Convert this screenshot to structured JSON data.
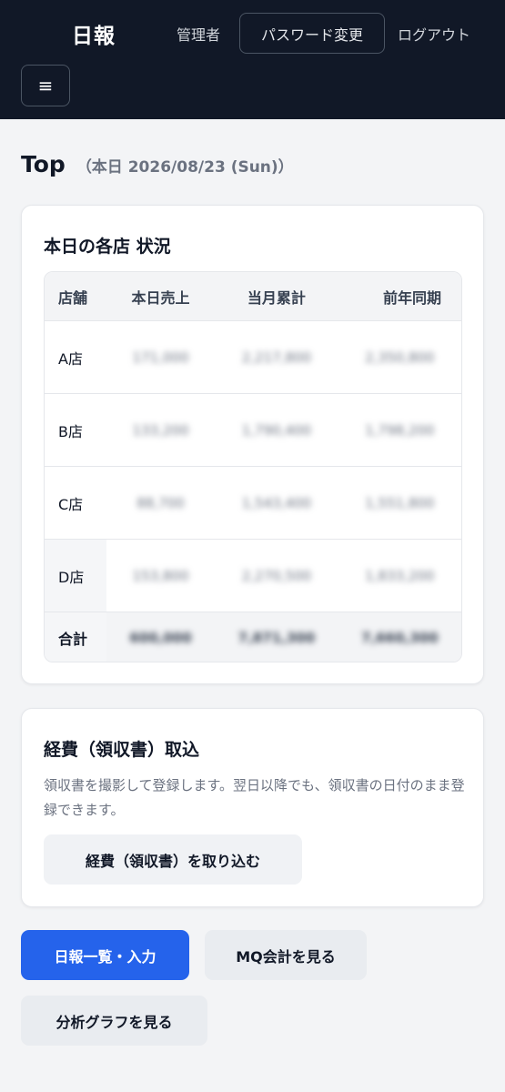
{
  "header": {
    "brand": "日報",
    "user": "管理者",
    "password_change": "パスワード変更",
    "logout": "ログアウト",
    "menu_icon": "≡"
  },
  "page": {
    "title": "Top",
    "date": "（本日 2026/08/23 (Sun)）"
  },
  "status_card": {
    "heading": "本日の各店 状況",
    "columns": [
      "店舗",
      "本日売上",
      "当月累計",
      "前年同期"
    ],
    "rows": [
      {
        "store": "A店",
        "today": "171,000",
        "month": "2,217,800",
        "last_year": "2,350,800"
      },
      {
        "store": "B店",
        "today": "133,200",
        "month": "1,790,400",
        "last_year": "1,798,200"
      },
      {
        "store": "C店",
        "today": "88,700",
        "month": "1,543,400",
        "last_year": "1,551,800"
      },
      {
        "store": "D店",
        "today": "153,800",
        "month": "2,270,500",
        "last_year": "1,833,200"
      }
    ],
    "total": {
      "store": "合計",
      "today": "600,000",
      "month": "7,871,300",
      "last_year": "7,660,300"
    }
  },
  "expense_card": {
    "heading": "経費（領収書）取込",
    "description": "領収書を撮影して登録します。翌日以降でも、領収書の日付のまま登録できます。",
    "button": "経費（領収書）を取り込む"
  },
  "actions": {
    "daily_report": "日報一覧・入力",
    "mq": "MQ会計を見る",
    "graph": "分析グラフを見る"
  },
  "colors": {
    "header_bg": "#111827",
    "primary": "#2563eb",
    "page_bg": "#f3f4f6"
  }
}
